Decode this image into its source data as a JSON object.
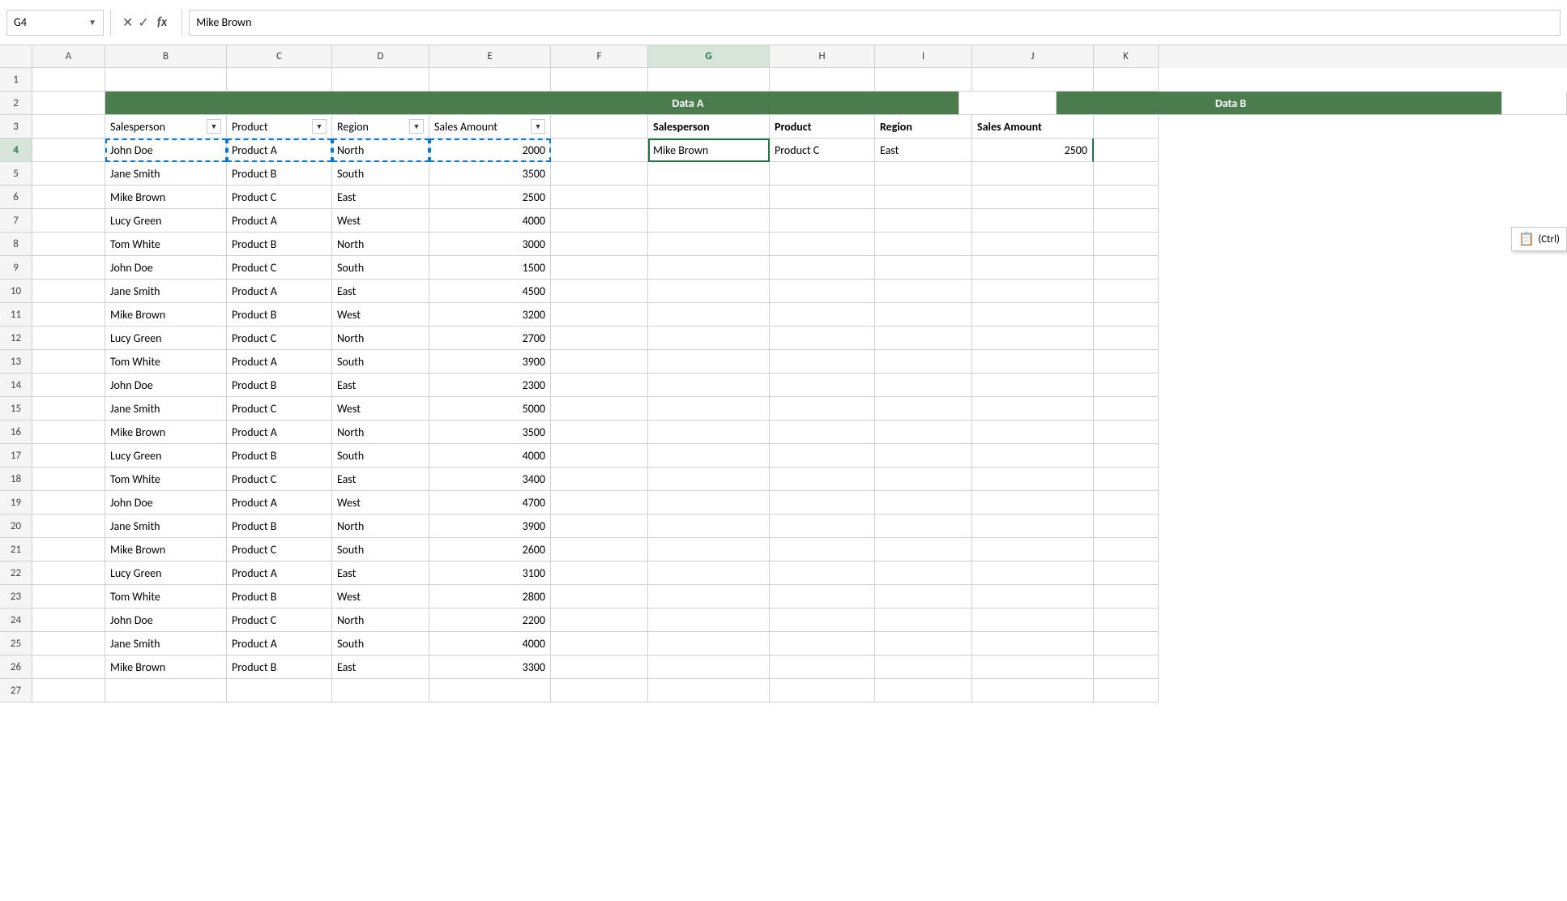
{
  "formulaBar": {
    "cellRef": "G4",
    "formulaValue": "Mike Brown",
    "icons": {
      "close": "✕",
      "check": "✓",
      "fx": "fx"
    }
  },
  "columns": [
    "A",
    "B",
    "C",
    "D",
    "E",
    "F",
    "G",
    "H",
    "I",
    "J",
    "K"
  ],
  "rowCount": 27,
  "dataA": {
    "title": "Data A",
    "headers": [
      "Salesperson",
      "Product",
      "Region",
      "Sales Amount"
    ],
    "rows": [
      [
        "John Doe",
        "Product A",
        "North",
        2000
      ],
      [
        "Jane Smith",
        "Product B",
        "South",
        3500
      ],
      [
        "Mike Brown",
        "Product C",
        "East",
        2500
      ],
      [
        "Lucy Green",
        "Product A",
        "West",
        4000
      ],
      [
        "Tom White",
        "Product B",
        "North",
        3000
      ],
      [
        "John Doe",
        "Product C",
        "South",
        1500
      ],
      [
        "Jane Smith",
        "Product A",
        "East",
        4500
      ],
      [
        "Mike Brown",
        "Product B",
        "West",
        3200
      ],
      [
        "Lucy Green",
        "Product C",
        "North",
        2700
      ],
      [
        "Tom White",
        "Product A",
        "South",
        3900
      ],
      [
        "John Doe",
        "Product B",
        "East",
        2300
      ],
      [
        "Jane Smith",
        "Product C",
        "West",
        5000
      ],
      [
        "Mike Brown",
        "Product A",
        "North",
        3500
      ],
      [
        "Lucy Green",
        "Product B",
        "South",
        4000
      ],
      [
        "Tom White",
        "Product C",
        "East",
        3400
      ],
      [
        "John Doe",
        "Product A",
        "West",
        4700
      ],
      [
        "Jane Smith",
        "Product B",
        "North",
        3900
      ],
      [
        "Mike Brown",
        "Product C",
        "South",
        2600
      ],
      [
        "Lucy Green",
        "Product A",
        "East",
        3100
      ],
      [
        "Tom White",
        "Product B",
        "West",
        2800
      ],
      [
        "John Doe",
        "Product C",
        "North",
        2200
      ],
      [
        "Jane Smith",
        "Product A",
        "South",
        4000
      ],
      [
        "Mike Brown",
        "Product B",
        "East",
        3300
      ]
    ]
  },
  "dataB": {
    "title": "Data B",
    "headers": [
      "Salesperson",
      "Product",
      "Region",
      "Sales Amount"
    ],
    "rows": [
      [
        "Mike Brown",
        "Product C",
        "East",
        2500
      ]
    ]
  },
  "pasteTooltip": "(Ctrl)"
}
